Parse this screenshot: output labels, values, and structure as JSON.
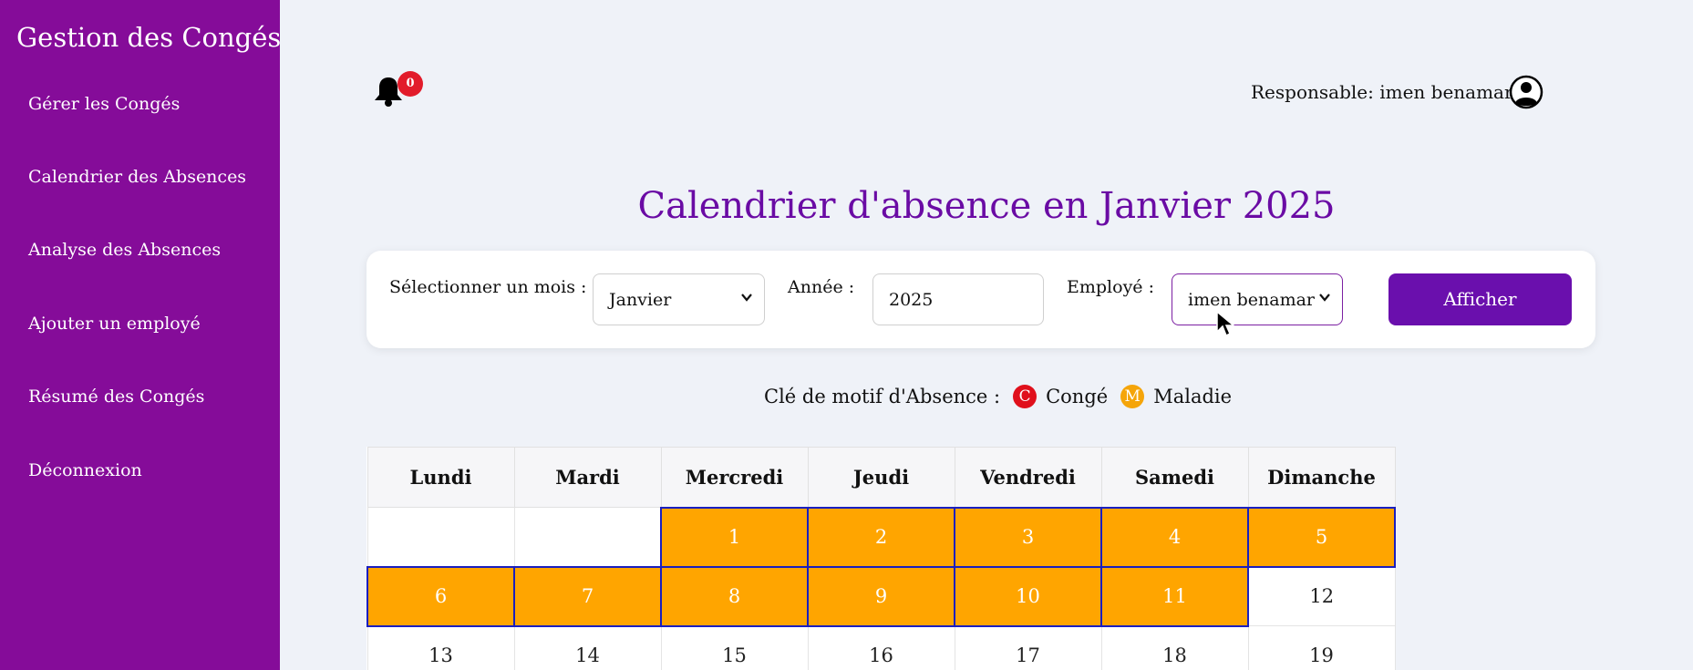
{
  "sidebar": {
    "brand": "Gestion des Congés",
    "items": [
      {
        "label": "Gérer les Congés"
      },
      {
        "label": "Calendrier des Absences"
      },
      {
        "label": "Analyse des Absences"
      },
      {
        "label": "Ajouter un employé"
      },
      {
        "label": "Résumé des Congés"
      },
      {
        "label": "Déconnexion"
      }
    ],
    "color": "#850c99"
  },
  "header": {
    "notifications_count": "0",
    "user_label": "Responsable: imen benamar",
    "icons": [
      "bell-icon",
      "user-avatar-icon"
    ]
  },
  "main": {
    "title": "Calendrier d'absence en Janvier 2025",
    "title_color": "#6a0ba4",
    "filters": {
      "month_label": "Sélectionner un mois :",
      "month_value": "Janvier",
      "year_label": "Année :",
      "year_value": "2025",
      "employee_label": "Employé :",
      "employee_value": "imen benamar",
      "submit_label": "Afficher"
    },
    "legend": {
      "label": "Clé de motif d'Absence :",
      "items": [
        {
          "letter": "C",
          "label": "Congé",
          "color": "#e0101c"
        },
        {
          "letter": "M",
          "label": "Maladie",
          "color": "#f5a50a"
        }
      ]
    },
    "calendar": {
      "weekdays": [
        "Lundi",
        "Mardi",
        "Mercredi",
        "Jeudi",
        "Vendredi",
        "Samedi",
        "Dimanche"
      ],
      "weeks": [
        [
          {
            "day": ""
          },
          {
            "day": ""
          },
          {
            "day": "1",
            "absent": true
          },
          {
            "day": "2",
            "absent": true
          },
          {
            "day": "3",
            "absent": true
          },
          {
            "day": "4",
            "absent": true
          },
          {
            "day": "5",
            "absent": true
          }
        ],
        [
          {
            "day": "6",
            "absent": true
          },
          {
            "day": "7",
            "absent": true
          },
          {
            "day": "8",
            "absent": true
          },
          {
            "day": "9",
            "absent": true
          },
          {
            "day": "10",
            "absent": true
          },
          {
            "day": "11",
            "absent": true
          },
          {
            "day": "12"
          }
        ],
        [
          {
            "day": "13"
          },
          {
            "day": "14"
          },
          {
            "day": "15"
          },
          {
            "day": "16"
          },
          {
            "day": "17"
          },
          {
            "day": "18"
          },
          {
            "day": "19"
          }
        ]
      ],
      "absent_color": "#ffa500"
    }
  }
}
